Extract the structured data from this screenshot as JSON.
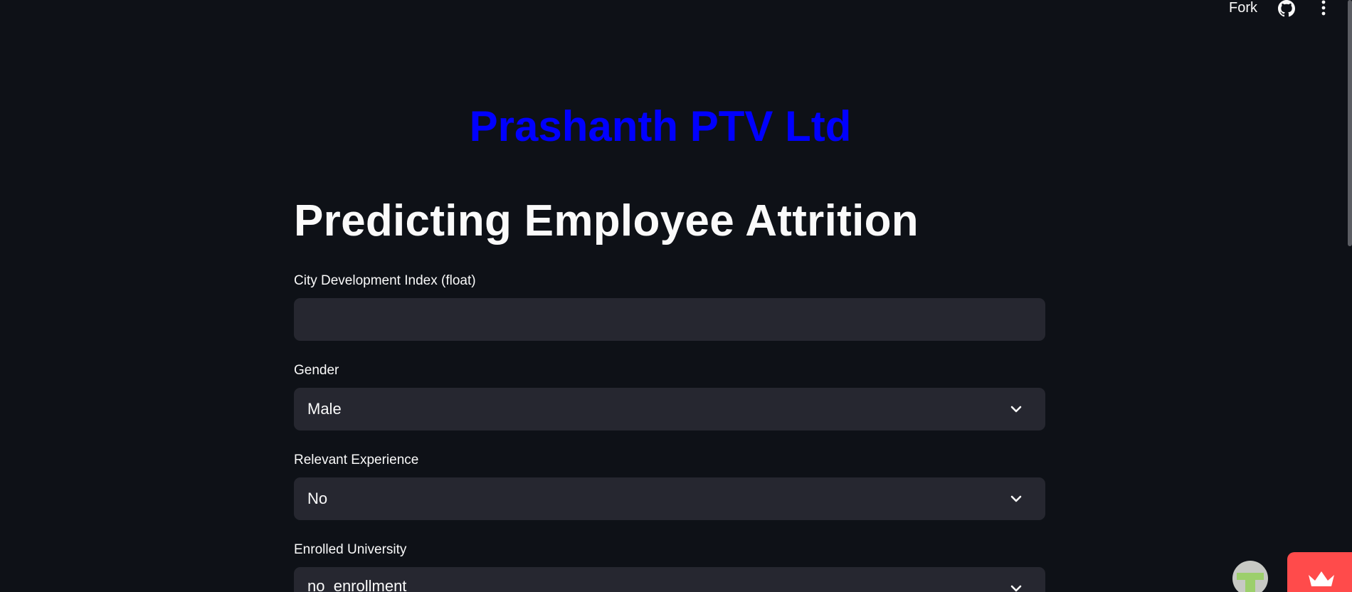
{
  "header": {
    "fork_label": "Fork",
    "github_icon": "github-icon",
    "menu_icon": "vertical-dots-menu-icon"
  },
  "main": {
    "brand_title": "Prashanth PTV Ltd",
    "page_title": "Predicting Employee Attrition",
    "fields": {
      "city_index": {
        "label": "City Development Index (float)",
        "value": "",
        "placeholder": ""
      },
      "gender": {
        "label": "Gender",
        "selected": "Male"
      },
      "relevant_experience": {
        "label": "Relevant Experience",
        "selected": "No"
      },
      "enrolled_university": {
        "label": "Enrolled University",
        "selected": "no_enrollment"
      }
    }
  },
  "colors": {
    "background": "#0e1117",
    "brand_title": "#0000ff",
    "input_bg": "#262730",
    "badge": "#ff4b4b"
  }
}
